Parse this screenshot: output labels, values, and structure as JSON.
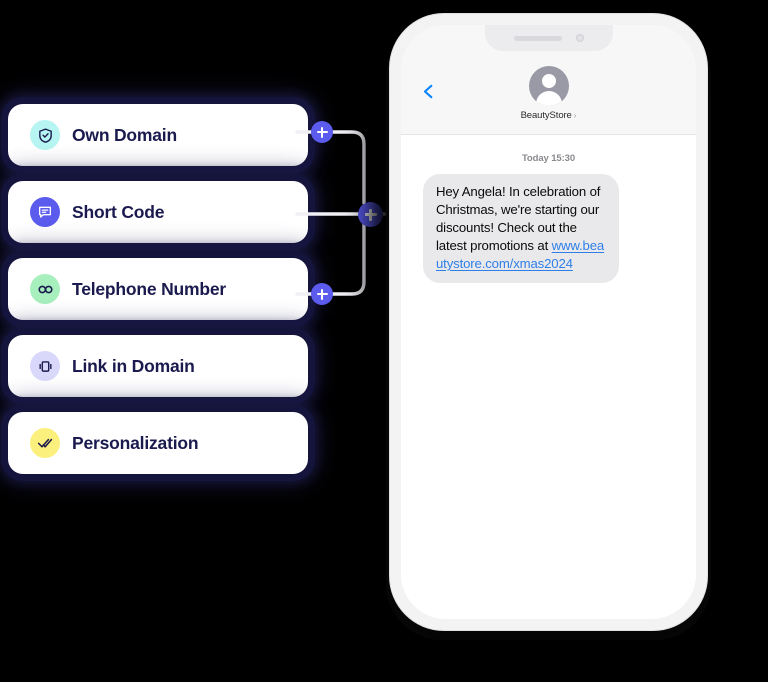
{
  "features": {
    "items": [
      {
        "label": "Own Domain",
        "icon": "shield-check-icon",
        "badge_color": "#b7f5f2",
        "glyph_color": "#1a1a4e"
      },
      {
        "label": "Short Code",
        "icon": "speech-bubble-icon",
        "badge_color": "#5b5bee",
        "glyph_color": "#ffffff"
      },
      {
        "label": "Telephone Number",
        "icon": "infinity-icon",
        "badge_color": "#a7f0bd",
        "glyph_color": "#1a1a4e"
      },
      {
        "label": "Link in Domain",
        "icon": "carousel-link-icon",
        "badge_color": "#d9d8fb",
        "glyph_color": "#1a1a4e"
      },
      {
        "label": "Personalization",
        "icon": "double-check-icon",
        "badge_color": "#fbf07e",
        "glyph_color": "#1a1a4e"
      }
    ]
  },
  "connectors": {
    "add_buttons": [
      {
        "name": "add-own-domain",
        "label": "+"
      },
      {
        "name": "add-merge",
        "label": "+"
      },
      {
        "name": "add-telephone-number",
        "label": "+"
      }
    ]
  },
  "phone": {
    "header": {
      "back_label": "Back",
      "contact_name": "BeautyStore",
      "contact_chevron": "›"
    },
    "chat": {
      "timestamp": "Today 15:30",
      "message_text": "Hey Angela! In celebration of Christmas, we're starting our discounts! Check out the latest promotions at ",
      "message_link": "www.beautystore.com/xmas2024"
    }
  },
  "colors": {
    "accent": "#5b5bee",
    "card_text": "#1a1a4e",
    "bubble_bg": "#e9e9eb",
    "link_blue": "#2f7fe8"
  }
}
